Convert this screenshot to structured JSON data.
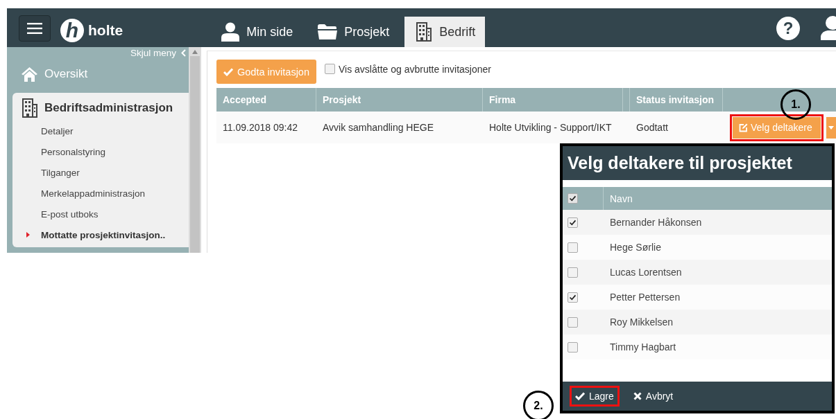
{
  "top_bar": {
    "logo_mark": "h",
    "logo_text": "holte",
    "tabs": [
      {
        "label": "Min side",
        "kind": "user",
        "selected": false
      },
      {
        "label": "Prosjekt",
        "kind": "folder",
        "selected": false
      },
      {
        "label": "Bedrift",
        "kind": "building",
        "selected": true
      }
    ],
    "help": "?"
  },
  "sidebar": {
    "hide_menu": "Skjul meny",
    "overview": "Oversikt",
    "section": {
      "title": "Bedriftsadministrasjon",
      "items": [
        {
          "label": "Detaljer",
          "selected": false
        },
        {
          "label": "Personalstyring",
          "selected": false
        },
        {
          "label": "Tilganger",
          "selected": false
        },
        {
          "label": "Merkelappadministrasjon",
          "selected": false
        },
        {
          "label": "E-post utboks",
          "selected": false
        },
        {
          "label": "Mottatte prosjektinvitasjon..",
          "selected": true
        }
      ]
    }
  },
  "main": {
    "accept_button": "Godta invitasjon",
    "show_declined": {
      "label": "Vis avslåtte og avbrutte invitasjoner",
      "checked": false
    },
    "table": {
      "columns": [
        "Accepted",
        "Prosjekt",
        "Firma",
        "Status invitasjon"
      ],
      "rows": [
        {
          "cells": [
            "11.09.2018 09:42",
            "Avvik samhandling HEGE",
            "Holte Utvikling - Support/IKT",
            "Godtatt"
          ],
          "action": "Velg deltakere",
          "action_highlighted": true
        }
      ]
    }
  },
  "dialog": {
    "title": "Velg deltakere til prosjektet",
    "select_all_checked": true,
    "column": "Navn",
    "rows": [
      {
        "name": "Bernander Håkonsen",
        "checked": true
      },
      {
        "name": "Hege Sørlie",
        "checked": false
      },
      {
        "name": "Lucas Lorentsen",
        "checked": false
      },
      {
        "name": "Petter Pettersen",
        "checked": true
      },
      {
        "name": "Roy Mikkelsen",
        "checked": false
      },
      {
        "name": "Timmy Hagbart",
        "checked": false
      }
    ],
    "buttons": [
      {
        "label": "Lagre",
        "kind": "save",
        "highlighted": true
      },
      {
        "label": "Avbryt",
        "kind": "cancel",
        "highlighted": false
      }
    ]
  },
  "annotations": [
    {
      "label": "1."
    },
    {
      "label": "2."
    }
  ]
}
